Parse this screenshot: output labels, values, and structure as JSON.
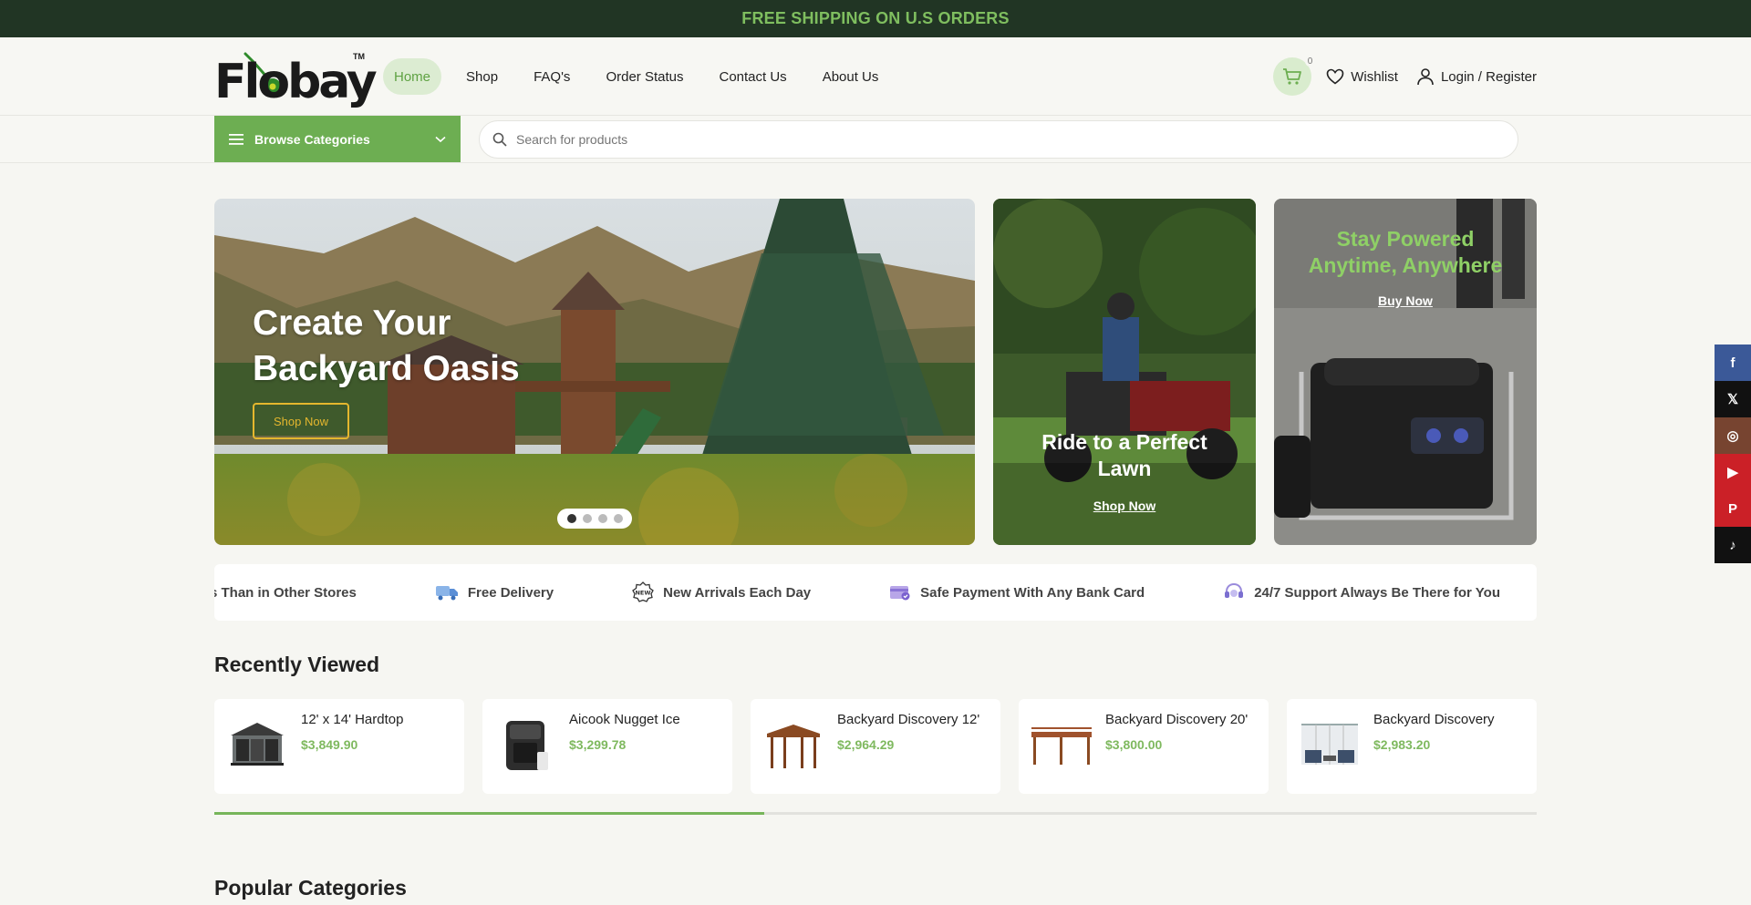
{
  "topbar": {
    "text": "FREE SHIPPING ON U.S ORDERS"
  },
  "logo": {
    "text": "Flobay",
    "tm": "TM"
  },
  "nav": [
    {
      "label": "Home",
      "active": true
    },
    {
      "label": "Shop"
    },
    {
      "label": "FAQ's"
    },
    {
      "label": "Order Status"
    },
    {
      "label": "Contact Us"
    },
    {
      "label": "About Us"
    }
  ],
  "header": {
    "cart_count": "0",
    "wishlist": "Wishlist",
    "login": "Login / Register"
  },
  "catbar": {
    "browse_label": "Browse Categories",
    "search_placeholder": "Search for products"
  },
  "hero": {
    "title_line1": "Create Your",
    "title_line2": "Backyard Oasis",
    "button": "Shop Now",
    "slide_count": 4,
    "active_slide": 1
  },
  "promo1": {
    "title_line1": "Ride to a Perfect",
    "title_line2": "Lawn",
    "link": "Shop Now"
  },
  "promo2": {
    "title_line1": "Stay Powered",
    "title_line2": "Anytime, Anywhere",
    "link": "Buy Now",
    "title_color": "#8fd066"
  },
  "features": [
    {
      "icon": "price-tag-icon",
      "text": "s Than in Other Stores"
    },
    {
      "icon": "delivery-truck-icon",
      "text": "Free Delivery"
    },
    {
      "icon": "new-badge-icon",
      "text": "New Arrivals Each Day"
    },
    {
      "icon": "payment-card-icon",
      "text": "Safe Payment With Any Bank Card"
    },
    {
      "icon": "support-headset-icon",
      "text": "24/7 Support Always Be There for You"
    }
  ],
  "recently_viewed": {
    "title": "Recently Viewed",
    "items": [
      {
        "name": "12' x 14' Hardtop",
        "price": "$3,849.90",
        "icon": "gazebo-hardtop-image"
      },
      {
        "name": "Aicook Nugget Ice",
        "price": "$3,299.78",
        "icon": "ice-maker-image"
      },
      {
        "name": "Backyard Discovery 12'",
        "price": "$2,964.29",
        "icon": "wood-pergola-image"
      },
      {
        "name": "Backyard Discovery 20'",
        "price": "$3,800.00",
        "icon": "wide-pergola-image"
      },
      {
        "name": "Backyard Discovery",
        "price": "$2,983.20",
        "icon": "patio-set-image"
      }
    ],
    "scroll_progress": 0.416
  },
  "popular": {
    "title": "Popular Categories"
  },
  "social": [
    {
      "icon": "facebook-icon",
      "glyph": "f",
      "color": "#3b5998"
    },
    {
      "icon": "x-icon",
      "glyph": "𝕏",
      "color": "#111111"
    },
    {
      "icon": "instagram-icon",
      "glyph": "◎",
      "color": "#774430"
    },
    {
      "icon": "youtube-icon",
      "glyph": "▶",
      "color": "#cb2027"
    },
    {
      "icon": "pinterest-icon",
      "glyph": "P",
      "color": "#cb2027"
    },
    {
      "icon": "tiktok-icon",
      "glyph": "♪",
      "color": "#111111"
    }
  ],
  "colors": {
    "brand_green": "#6dae52",
    "dark_green": "#213524",
    "price_green": "#7fb95f"
  }
}
